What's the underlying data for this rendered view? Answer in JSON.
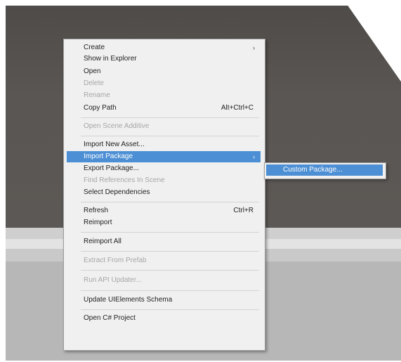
{
  "context_menu": {
    "items": [
      {
        "label": "Create",
        "submenu": true,
        "disabled": false
      },
      {
        "label": "Show in Explorer",
        "disabled": false
      },
      {
        "label": "Open",
        "disabled": false
      },
      {
        "label": "Delete",
        "disabled": true
      },
      {
        "label": "Rename",
        "disabled": true
      },
      {
        "label": "Copy Path",
        "shortcut": "Alt+Ctrl+C",
        "disabled": false
      },
      {
        "label": "Open Scene Additive",
        "disabled": true
      },
      {
        "label": "Import New Asset...",
        "disabled": false
      },
      {
        "label": "Import Package",
        "submenu": true,
        "highlighted": true,
        "disabled": false
      },
      {
        "label": "Export Package...",
        "disabled": false
      },
      {
        "label": "Find References In Scene",
        "disabled": true
      },
      {
        "label": "Select Dependencies",
        "disabled": false
      },
      {
        "label": "Refresh",
        "shortcut": "Ctrl+R",
        "disabled": false
      },
      {
        "label": "Reimport",
        "disabled": false
      },
      {
        "label": "Reimport All",
        "disabled": false
      },
      {
        "label": "Extract From Prefab",
        "disabled": true
      },
      {
        "label": "Run API Updater...",
        "disabled": true
      },
      {
        "label": "Update UIElements Schema",
        "disabled": false
      },
      {
        "label": "Open C# Project",
        "disabled": false
      }
    ],
    "submenu_arrow": "›"
  },
  "submenu": {
    "items": [
      {
        "label": "Custom Package...",
        "highlighted": true
      }
    ]
  },
  "colors": {
    "background_dark": "#5a5653",
    "menu_background": "#f0f0f0",
    "highlight": "#4d8fd4",
    "disabled_text": "#a6a6a6"
  }
}
